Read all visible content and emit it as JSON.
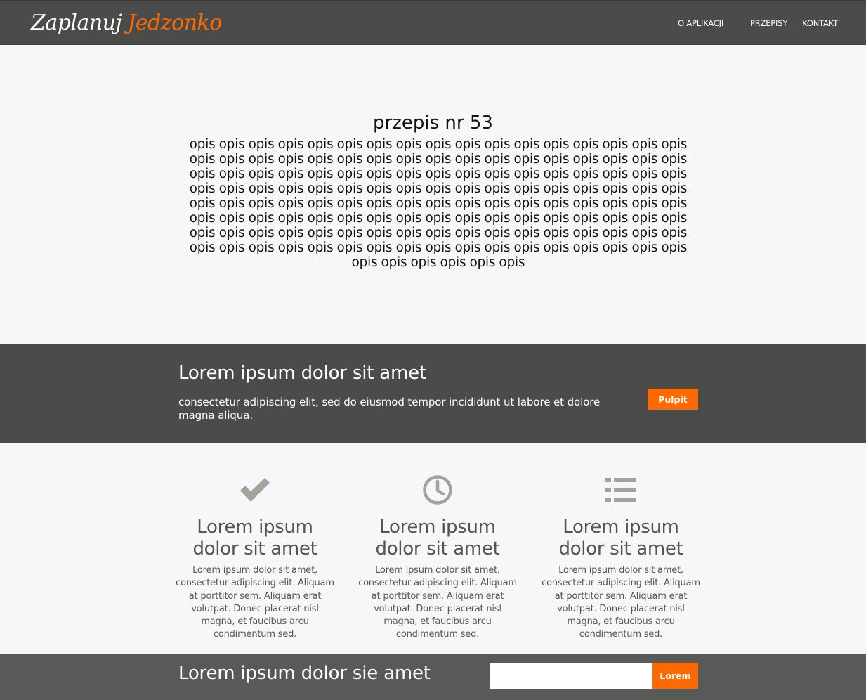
{
  "navbar": {
    "brand_part1": "Zaplanuj",
    "brand_part2": "Jedzonko",
    "links": [
      "O APLIKACJI",
      "PRZEPISY",
      "KONTAKT"
    ]
  },
  "recipe": {
    "title": "przepis nr 53",
    "description": "opis opis opis opis opis opis opis opis opis opis opis opis opis opis opis opis opis opis opis opis opis opis opis opis opis opis opis opis opis opis opis opis opis opis opis opis opis opis opis opis opis opis opis opis opis opis opis opis opis opis opis opis opis opis opis opis opis opis opis opis opis opis opis opis opis opis opis opis opis opis opis opis opis opis opis opis opis opis opis opis opis opis opis opis opis opis opis opis opis opis opis opis opis opis opis opis opis opis opis opis opis opis opis opis opis opis opis opis opis opis opis opis opis opis opis opis opis opis opis opis opis opis opis opis opis opis opis opis opis opis opis opis opis opis opis opis opis opis opis opis opis opis"
  },
  "banner": {
    "title": "Lorem ipsum dolor sit amet",
    "text": "consectetur adipiscing elit, sed do eiusmod tempor incididunt ut labore et dolore magna aliqua.",
    "button": "Pulpit"
  },
  "features": [
    {
      "icon": "check-icon",
      "title": "Lorem ipsum dolor sit amet",
      "text": "Lorem ipsum dolor sit amet, consectetur adipiscing elit. Aliquam at porttitor sem. Aliquam erat volutpat. Donec placerat nisl magna, et faucibus arcu condimentum sed."
    },
    {
      "icon": "clock-icon",
      "title": "Lorem ipsum dolor sit amet",
      "text": "Lorem ipsum dolor sit amet, consectetur adipiscing elit. Aliquam at porttitor sem. Aliquam erat volutpat. Donec placerat nisl magna, et faucibus arcu condimentum sed."
    },
    {
      "icon": "list-icon",
      "title": "Lorem ipsum dolor sit amet",
      "text": "Lorem ipsum dolor sit amet, consectetur adipiscing elit. Aliquam at porttitor sem. Aliquam erat volutpat. Donec placerat nisl magna, et faucibus arcu condimentum sed."
    }
  ],
  "footer": {
    "title": "Lorem ipsum dolor sie amet",
    "input_value": "",
    "button": "Lorem"
  },
  "colors": {
    "nav_bg": "#4b4b4a",
    "accent": "#ff6a00",
    "page_bg": "#f6f7f9",
    "footer_bg": "#585a58",
    "icon": "#a3a39c"
  }
}
